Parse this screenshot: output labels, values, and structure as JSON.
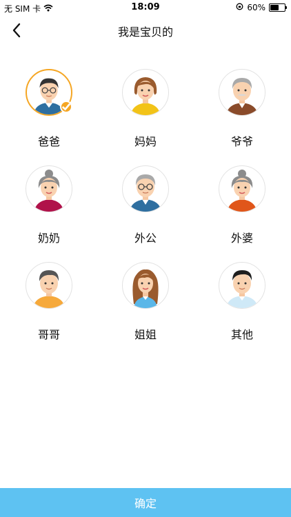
{
  "status_bar": {
    "carrier": "无 SIM 卡",
    "time": "18:09",
    "battery_percent": "60%",
    "battery_level": 0.6,
    "icons": [
      "wifi-icon",
      "orientation-lock-icon",
      "battery-icon"
    ]
  },
  "nav": {
    "title": "我是宝贝的",
    "back_icon": "chevron-left-icon"
  },
  "roles": [
    {
      "label": "爸爸",
      "selected": true
    },
    {
      "label": "妈妈",
      "selected": false
    },
    {
      "label": "爷爷",
      "selected": false
    },
    {
      "label": "奶奶",
      "selected": false
    },
    {
      "label": "外公",
      "selected": false
    },
    {
      "label": "外婆",
      "selected": false
    },
    {
      "label": "哥哥",
      "selected": false
    },
    {
      "label": "姐姐",
      "selected": false
    },
    {
      "label": "其他",
      "selected": false
    }
  ],
  "confirm_label": "确定",
  "colors": {
    "accent": "#5ec2f2",
    "selected_ring": "#f5a623"
  }
}
